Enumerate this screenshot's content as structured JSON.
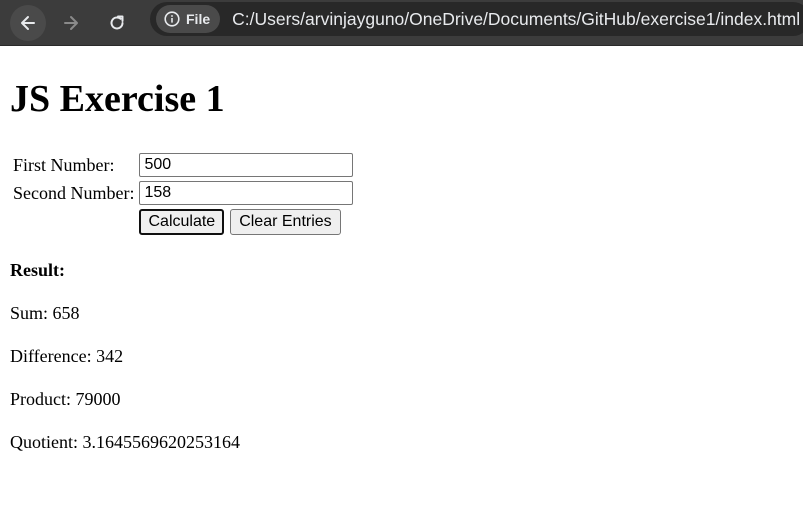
{
  "browser": {
    "chip_label": "File",
    "url": "C:/Users/arvinjayguno/OneDrive/Documents/GitHub/exercise1/index.html"
  },
  "page": {
    "title": "JS Exercise 1",
    "form": {
      "first_label": "First Number:",
      "first_value": "500",
      "second_label": "Second Number:",
      "second_value": "158",
      "calculate_label": "Calculate",
      "clear_label": "Clear Entries"
    },
    "result": {
      "heading": "Result:",
      "sum": "Sum: 658",
      "difference": "Difference: 342",
      "product": "Product: 79000",
      "quotient": "Quotient: 3.1645569620253164"
    }
  }
}
